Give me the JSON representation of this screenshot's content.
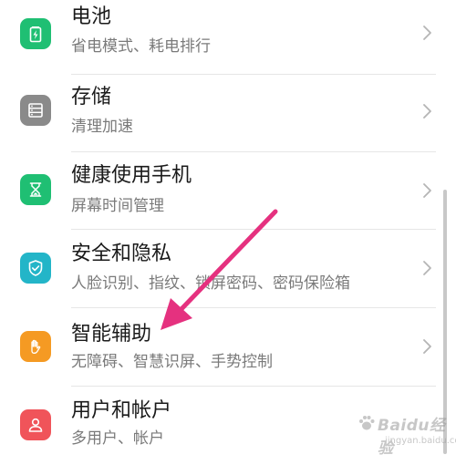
{
  "settings": {
    "items": [
      {
        "title": "电池",
        "subtitle": "省电模式、耗电排行",
        "icon": "battery-icon",
        "color": "#1fbf73"
      },
      {
        "title": "存储",
        "subtitle": "清理加速",
        "icon": "storage-icon",
        "color": "#8a8a8a"
      },
      {
        "title": "健康使用手机",
        "subtitle": "屏幕时间管理",
        "icon": "hourglass-icon",
        "color": "#1fbf73"
      },
      {
        "title": "安全和隐私",
        "subtitle": "人脸识别、指纹、锁屏密码、密码保险箱",
        "icon": "shield-icon",
        "color": "#23b5c8"
      },
      {
        "title": "智能辅助",
        "subtitle": "无障碍、智慧识屏、手势控制",
        "icon": "hand-icon",
        "color": "#f59a23"
      },
      {
        "title": "用户和帐户",
        "subtitle": "多用户、帐户",
        "icon": "user-icon",
        "color": "#f0545a"
      }
    ]
  },
  "annotation": {
    "color": "#e5317f"
  },
  "watermark": {
    "brand": "Baidu经验",
    "url": "jingyan.baidu.com"
  }
}
